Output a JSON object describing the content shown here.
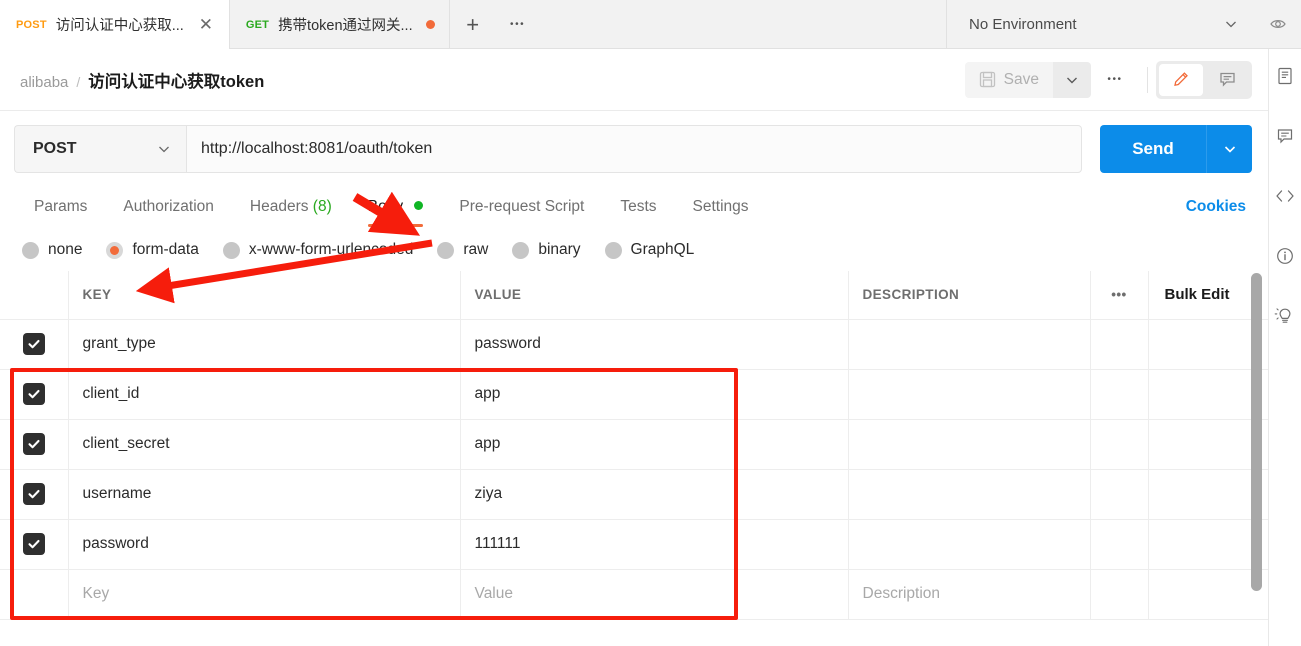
{
  "tabstrip": {
    "tabs": [
      {
        "method": "POST",
        "title": "访问认证中心获取...",
        "active": true,
        "close_glyph": "✕",
        "unsaved": false
      },
      {
        "method": "GET",
        "title": "携带token通过网关...",
        "active": false,
        "close_glyph": "",
        "unsaved": true
      }
    ],
    "new_tab_glyph": "+",
    "more_glyph": "•••",
    "environment": {
      "label": "No Environment"
    }
  },
  "request_header": {
    "collection": "alibaba",
    "separator": "/",
    "name": "访问认证中心获取token",
    "save_label": "Save",
    "more_glyph": "•••"
  },
  "url_bar": {
    "method": "POST",
    "url": "http://localhost:8081/oauth/token",
    "send_label": "Send"
  },
  "section_tabs": {
    "items": [
      {
        "label": "Params",
        "active": false
      },
      {
        "label": "Authorization",
        "active": false
      },
      {
        "label": "Headers",
        "count": "(8)",
        "active": false
      },
      {
        "label": "Body",
        "active": true,
        "dot": true
      },
      {
        "label": "Pre-request Script",
        "active": false
      },
      {
        "label": "Tests",
        "active": false
      },
      {
        "label": "Settings",
        "active": false
      }
    ],
    "cookies_label": "Cookies"
  },
  "body_types": {
    "options": [
      {
        "label": "none",
        "selected": false
      },
      {
        "label": "form-data",
        "selected": true
      },
      {
        "label": "x-www-form-urlencoded",
        "selected": false
      },
      {
        "label": "raw",
        "selected": false
      },
      {
        "label": "binary",
        "selected": false
      },
      {
        "label": "GraphQL",
        "selected": false
      }
    ]
  },
  "form_table": {
    "headers": {
      "key": "KEY",
      "value": "VALUE",
      "description": "DESCRIPTION",
      "options_glyph": "•••",
      "bulk_edit": "Bulk Edit"
    },
    "rows": [
      {
        "checked": true,
        "key": "grant_type",
        "value": "password",
        "description": ""
      },
      {
        "checked": true,
        "key": "client_id",
        "value": "app",
        "description": ""
      },
      {
        "checked": true,
        "key": "client_secret",
        "value": "app",
        "description": ""
      },
      {
        "checked": true,
        "key": "username",
        "value": "ziya",
        "description": ""
      },
      {
        "checked": true,
        "key": "password",
        "value": "111111",
        "description": ""
      }
    ],
    "placeholder_row": {
      "key": "Key",
      "value": "Value",
      "description": "Description"
    }
  },
  "right_rail": {
    "icons": [
      {
        "name": "eye-icon"
      },
      {
        "name": "document-icon"
      },
      {
        "name": "comment-icon"
      },
      {
        "name": "code-icon"
      },
      {
        "name": "info-icon"
      },
      {
        "name": "lightbulb-icon"
      }
    ]
  },
  "annotations": {
    "highlight_color": "#f61d0c",
    "arrow_body_tab": "points to Body tab",
    "arrow_form_data": "points to form-data radio",
    "box_form_rows": "outlines the 5 form-data key/value rows"
  },
  "colors": {
    "accent_orange": "#f26b3a",
    "send_blue": "#0c8ce9",
    "method_post": "#ff9b11",
    "method_get": "#2aa91f",
    "green_dot": "#10b525"
  }
}
